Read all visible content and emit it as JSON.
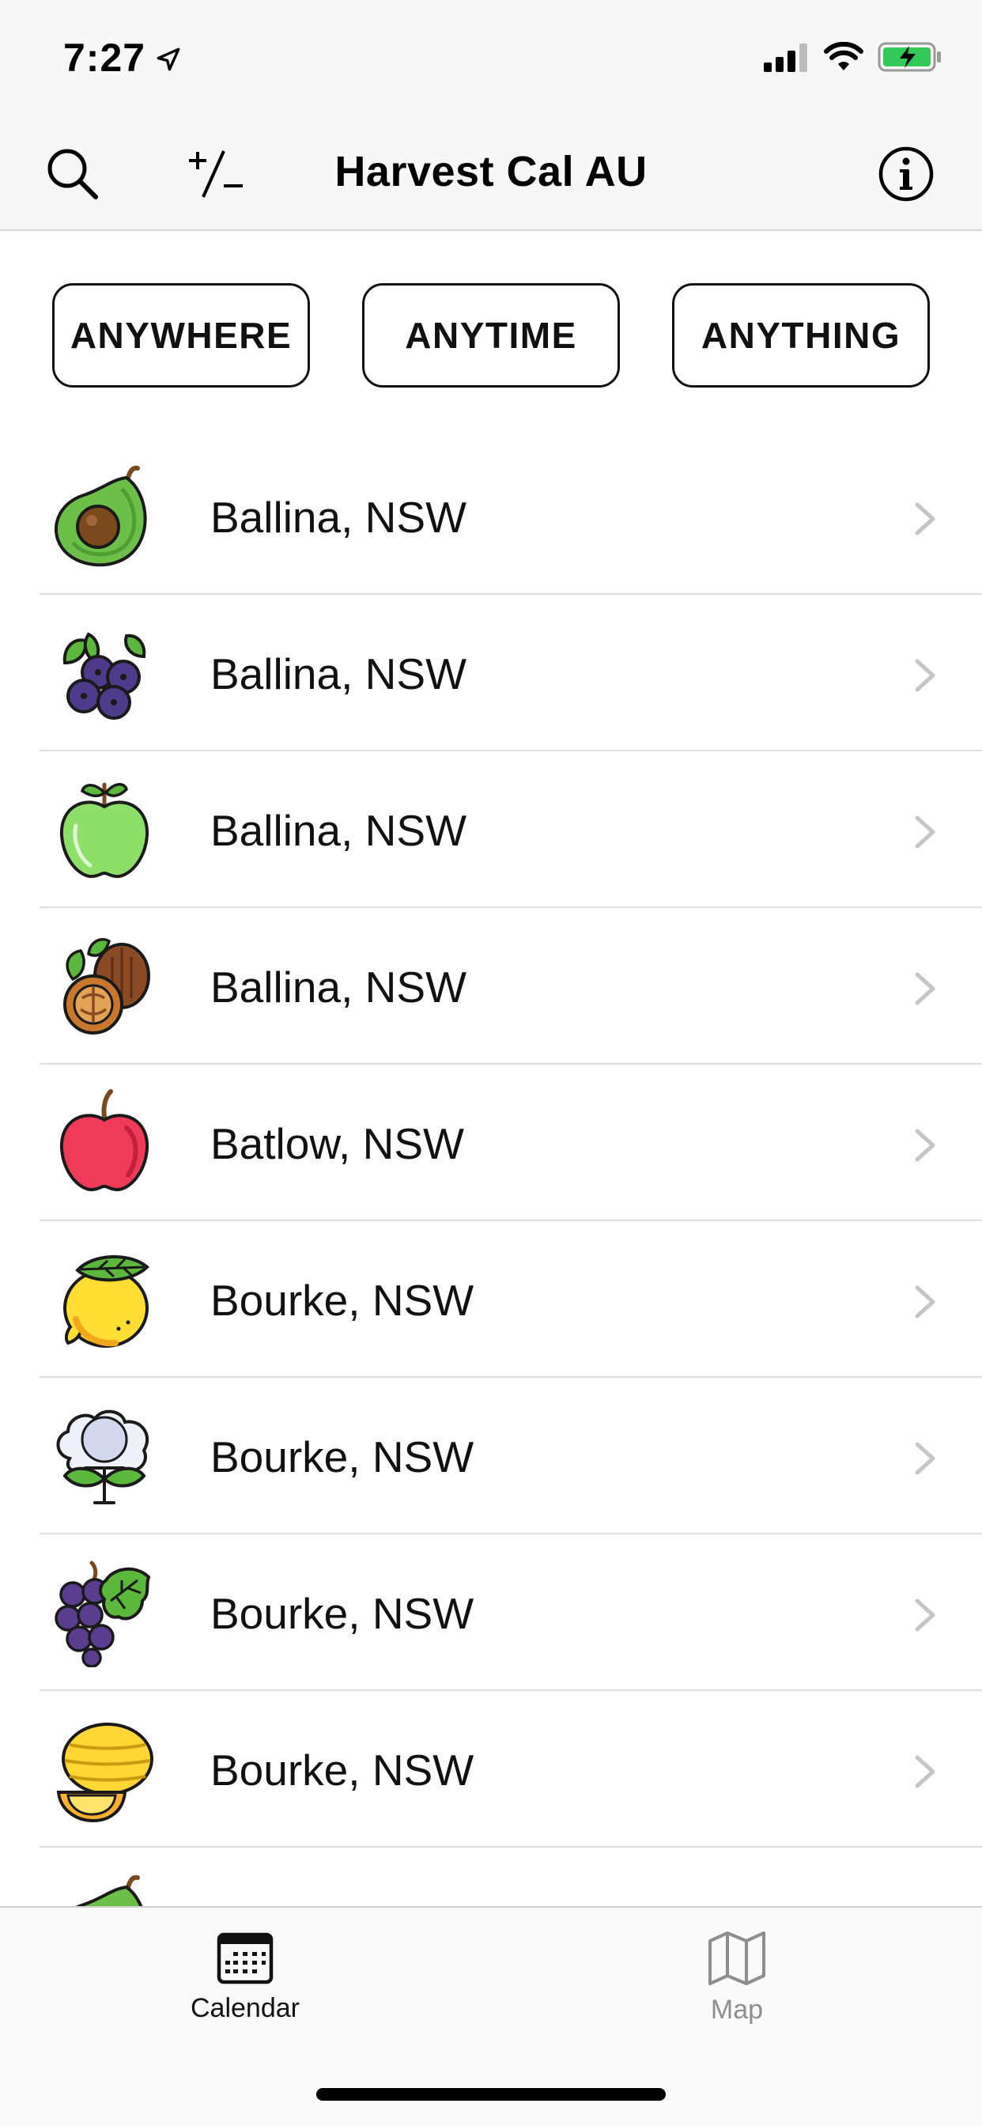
{
  "status": {
    "time": "7:27"
  },
  "nav": {
    "title": "Harvest Cal AU"
  },
  "filters": [
    {
      "label": "ANYWHERE"
    },
    {
      "label": "ANYTIME"
    },
    {
      "label": "ANYTHING"
    }
  ],
  "list": [
    {
      "label": "Ballina, NSW",
      "icon": "avocado-icon"
    },
    {
      "label": "Ballina, NSW",
      "icon": "blueberries-icon"
    },
    {
      "label": "Ballina, NSW",
      "icon": "green-apple-icon"
    },
    {
      "label": "Ballina, NSW",
      "icon": "walnut-icon"
    },
    {
      "label": "Batlow, NSW",
      "icon": "red-apple-icon"
    },
    {
      "label": "Bourke, NSW",
      "icon": "lemon-icon"
    },
    {
      "label": "Bourke, NSW",
      "icon": "cotton-icon"
    },
    {
      "label": "Bourke, NSW",
      "icon": "grapes-icon"
    },
    {
      "label": "Bourke, NSW",
      "icon": "melon-icon"
    },
    {
      "label": "",
      "icon": "avocado-icon"
    }
  ],
  "tabs": [
    {
      "label": "Calendar",
      "icon": "calendar-icon",
      "active": true
    },
    {
      "label": "Map",
      "icon": "map-icon",
      "active": false
    }
  ]
}
